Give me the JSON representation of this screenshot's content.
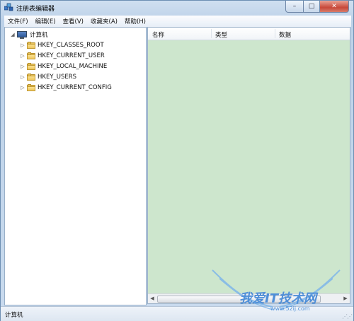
{
  "window": {
    "title": "注册表编辑器",
    "controls": {
      "minimize": "–",
      "maximize": "□",
      "close": "✕"
    }
  },
  "menu": [
    "文件(F)",
    "编辑(E)",
    "查看(V)",
    "收藏夹(A)",
    "帮助(H)"
  ],
  "tree": {
    "root": {
      "label": "计算机",
      "expander": "◢",
      "icon": "computer-icon"
    },
    "children": [
      {
        "label": "HKEY_CLASSES_ROOT",
        "expander": "▷",
        "icon": "folder-icon"
      },
      {
        "label": "HKEY_CURRENT_USER",
        "expander": "▷",
        "icon": "folder-icon"
      },
      {
        "label": "HKEY_LOCAL_MACHINE",
        "expander": "▷",
        "icon": "folder-icon"
      },
      {
        "label": "HKEY_USERS",
        "expander": "▷",
        "icon": "folder-icon"
      },
      {
        "label": "HKEY_CURRENT_CONFIG",
        "expander": "▷",
        "icon": "folder-icon"
      }
    ]
  },
  "list": {
    "columns": [
      "名称",
      "类型",
      "数据"
    ],
    "scroll": {
      "left": "◀",
      "right": "▶"
    }
  },
  "status": {
    "text": "计算机"
  },
  "watermark": {
    "text": "我爱IT技术网",
    "url": "www.52ij.com"
  },
  "colors": {
    "list_bg": "#cde6cd",
    "title_bg": "#bcd1e8",
    "close": "#c8493a"
  }
}
